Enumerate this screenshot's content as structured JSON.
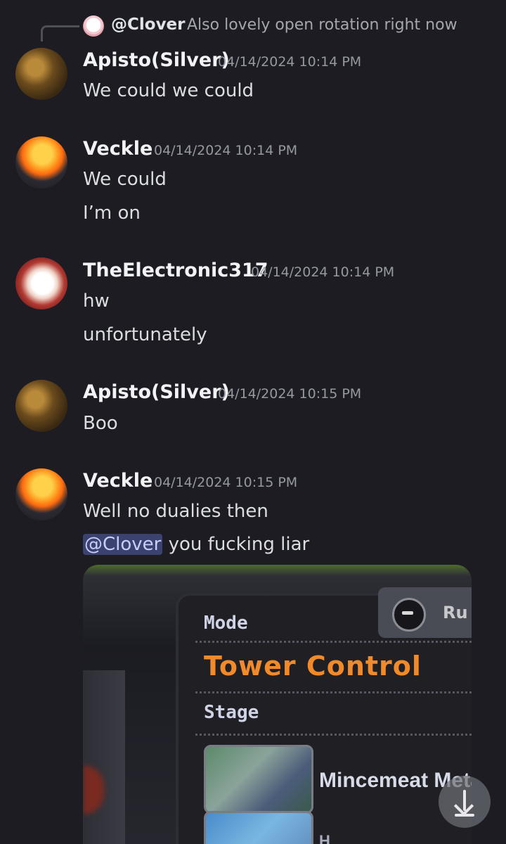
{
  "reply": {
    "name": "@Clover",
    "text": "Also lovely open rotation right now"
  },
  "messages": [
    {
      "username": "Apisto(Silver)",
      "timestamp": "04/14/2024 10:14 PM",
      "lines": [
        "We could we could"
      ]
    },
    {
      "username": "Veckle",
      "timestamp": "04/14/2024 10:14 PM",
      "lines": [
        "We could",
        "I’m on"
      ]
    },
    {
      "username": "TheElectronic317",
      "timestamp": "04/14/2024 10:14 PM",
      "lines": [
        "hw",
        "unfortunately"
      ]
    },
    {
      "username": "Apisto(Silver)",
      "timestamp": "04/14/2024 10:15 PM",
      "lines": [
        "Boo"
      ]
    },
    {
      "username": "Veckle",
      "timestamp": "04/14/2024 10:15 PM",
      "lines": [
        "Well no dualies then"
      ],
      "mention": "@Clover",
      "mention_suffix": " you fucking liar"
    }
  ],
  "attachment": {
    "rule_button": "Ru",
    "mode_label": "Mode",
    "mode_value": "Tower Control",
    "stage_label": "Stage",
    "stage_name": "Mincemeat Meta",
    "stage_name_2": "H"
  },
  "icons": {
    "scroll_down": "arrow-down-to-line-icon"
  }
}
